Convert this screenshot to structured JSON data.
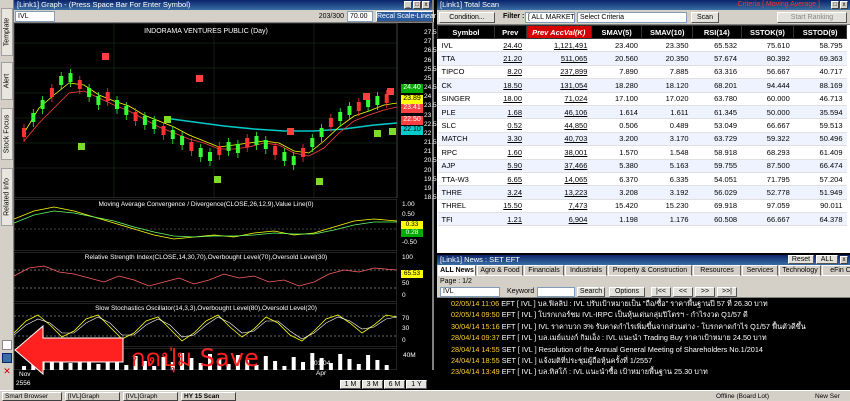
{
  "vertical_tabs": [
    "Template",
    "Alert",
    "Stock Focus",
    "Related Info"
  ],
  "graph": {
    "title": "[Link1] Graph - (Press Space Bar For Enter Symbol)",
    "symbol": "IVL",
    "counter": "203/300",
    "zoom": "70.00",
    "scale_button": "Recal Scale-Linear",
    "chart_title": "INDORAMA VENTURES PUBLIC (Day)",
    "price_ticks": [
      "27.5",
      "27",
      "26.5",
      "26",
      "25.5",
      "25",
      "24.5",
      "24",
      "23.5",
      "23",
      "22.5",
      "22",
      "21.5",
      "21",
      "20.5",
      "20",
      "19.5",
      "19",
      "18.5"
    ],
    "price_tags": [
      "24.40",
      "23.89",
      "23.41",
      "22.50",
      "22.10"
    ],
    "macd_title": "Moving Average Convergence / Divergence(CLOSE,26,12,9),Value Line(0)",
    "macd_ticks": [
      "1.00",
      "0.50",
      "0.00",
      "-0.50"
    ],
    "macd_tags": [
      "0.33",
      "0.28"
    ],
    "rsi_title": "Relative Strength Index(CLOSE,14,30,70),Overbought Level(70),Oversold Level(30)",
    "rsi_ticks": [
      "100",
      "50",
      "0"
    ],
    "rsi_tag": "65.53",
    "stoch_title": "Slow Stochastics Oscillator(14,3,3),Overbought Level(80),Oversold Level(20)",
    "stoch_ticks": [
      "70",
      "30",
      "0"
    ],
    "vol_tick": "40M",
    "date_labels": [
      "01/04",
      "Apr"
    ],
    "period_buttons": [
      "1 M",
      "3 M",
      "6 M",
      "1 Y"
    ],
    "bottom_fields": [
      "2556",
      "Nov"
    ],
    "annotation": "กดปุ่ม Save"
  },
  "scan": {
    "title": "[Link1] Total Scan",
    "window_label": "Criteria [ Moving Average ]",
    "condition_button": "Condition...",
    "filter_label": "Filter :",
    "filter_value": "[ ALL MARKET ]",
    "criteria_placeholder": "Select Criteria",
    "scan_button": "Scan",
    "ranking_button": "Start Ranking",
    "columns": [
      "Symbol",
      "Prev",
      "Prev AccVal(K)",
      "SMAV(5)",
      "SMAV(10)",
      "RSI(14)",
      "SSTOK(9)",
      "SSTOD(9)"
    ],
    "rows": [
      [
        "IVL",
        "24.40",
        "1,121,491",
        "23.400",
        "23.350",
        "65.532",
        "75.610",
        "58.795"
      ],
      [
        "TTA",
        "21.20",
        "511,065",
        "20.560",
        "20.350",
        "57.674",
        "80.392",
        "69.363"
      ],
      [
        "TIPCO",
        "8.20",
        "237,899",
        "7.890",
        "7.885",
        "63.316",
        "56.667",
        "40.717"
      ],
      [
        "CK",
        "18.50",
        "131,054",
        "18.280",
        "18.120",
        "68.201",
        "94.444",
        "88.169"
      ],
      [
        "SINGER",
        "18.00",
        "71,024",
        "17.100",
        "17.020",
        "63.780",
        "60.000",
        "46.713"
      ],
      [
        "PLE",
        "1.68",
        "46,106",
        "1.614",
        "1.611",
        "61.345",
        "50.000",
        "35.594"
      ],
      [
        "SLC",
        "0.52",
        "44,850",
        "0.506",
        "0.489",
        "53.049",
        "66.667",
        "59.513"
      ],
      [
        "MATCH",
        "3.30",
        "40,703",
        "3.200",
        "3.170",
        "63.729",
        "59.322",
        "50.496"
      ],
      [
        "RPC",
        "1.60",
        "38,001",
        "1.570",
        "1.548",
        "58.918",
        "68.293",
        "61.409"
      ],
      [
        "AJP",
        "5.90",
        "37,466",
        "5.380",
        "5.163",
        "59.755",
        "87.500",
        "66.474"
      ],
      [
        "TTA-W3",
        "6.65",
        "14,065",
        "6.370",
        "6.335",
        "54.051",
        "71.795",
        "57.204"
      ],
      [
        "THRE",
        "3.24",
        "13,223",
        "3.208",
        "3.192",
        "56.029",
        "52.778",
        "51.949"
      ],
      [
        "THREL",
        "15.50",
        "7,473",
        "15.420",
        "15.230",
        "69.918",
        "97.059",
        "90.011"
      ],
      [
        "TFI",
        "1.21",
        "6,904",
        "1.198",
        "1.176",
        "60.508",
        "66.667",
        "64.378"
      ]
    ]
  },
  "news": {
    "title": "[Link1] News : SET EFT",
    "window_label": "Previous | Reset",
    "reset_button": "Reset",
    "all_button": "ALL",
    "filter_value": "CC",
    "tabs": [
      "ALL News",
      "Agro & Food",
      "Financials",
      "Industrials",
      "Property & Construction",
      "Resources",
      "Services",
      "Technology",
      "eFin C"
    ],
    "page_label": "Page : 1/2",
    "symbol_value": "IVL",
    "keyword_label": "Keyword",
    "search_button": "Search",
    "options_button": "Options",
    "nav_buttons": [
      "|<<",
      "<<",
      ">>",
      ">>|"
    ],
    "items": [
      {
        "date": "02/05/14 11:06",
        "src": "EFT",
        "sym": "[ IVL ]",
        "text": "บล.ฟิลลิป : IVL ปรับเป้าหมายเป็น \"ถือ/ซื้อ\" ราคาพื้นฐานปี 57 ที่ 26.30 บาท"
      },
      {
        "date": "02/05/14 09:50",
        "src": "EFT",
        "sym": "[ IVL ]",
        "text": "โบรกเกอร์ชม IVL-IRPC เป็นหุ้นเด่นกลุ่มปิโตรฯ - กำไรงวด Q1/57 ดี"
      },
      {
        "date": "30/04/14 15:16",
        "src": "EFT",
        "sym": "[ IVL ]",
        "text": "IVL ราคาบวก 3% รับคาดกำไรเพิ่มขึ้นจากส่วนต่าง - โบรกคาดกำไร Q1/57 ฟื้นตัวดีขึ้น"
      },
      {
        "date": "28/04/14 09:37",
        "src": "EFT",
        "sym": "[ IVL ]",
        "text": "บล.เมย์แบงก์ กิมเอ็ง : IVL แนะนำ Trading Buy ราคาเป้าหมาย 24.50 บาท"
      },
      {
        "date": "28/04/14 14:55",
        "src": "SET",
        "sym": "[ IVL ]",
        "text": "Resolution of the Annual General Meeting of Shareholders No.1/2014"
      },
      {
        "date": "24/04/14 18:55",
        "src": "SET",
        "sym": "[ IVL ]",
        "text": "แจ้งมติที่ประชุมผู้ถือหุ้นครั้งที่ 1/2557"
      },
      {
        "date": "23/04/14 13:49",
        "src": "EFT",
        "sym": "[ IVL ]",
        "text": "บล.ทิสโก้ : IVL แนะนำซื้อ เป้าหมายพื้นฐาน 25.30 บาท"
      }
    ]
  },
  "taskbar": {
    "items": [
      "Smart Browser",
      "[IVL]Graph",
      "[IVL]Graph",
      "HY 15 Scan"
    ],
    "status": "Offline (Board Lot)",
    "right_label": "New Ser"
  },
  "colors": {
    "scan_header_highlight": "#d40000",
    "price_tag_green": "#00aa00",
    "price_tag_cyan": "#00cccc",
    "annotation_red": "#ff2020",
    "news_date": "#ffcc33"
  }
}
